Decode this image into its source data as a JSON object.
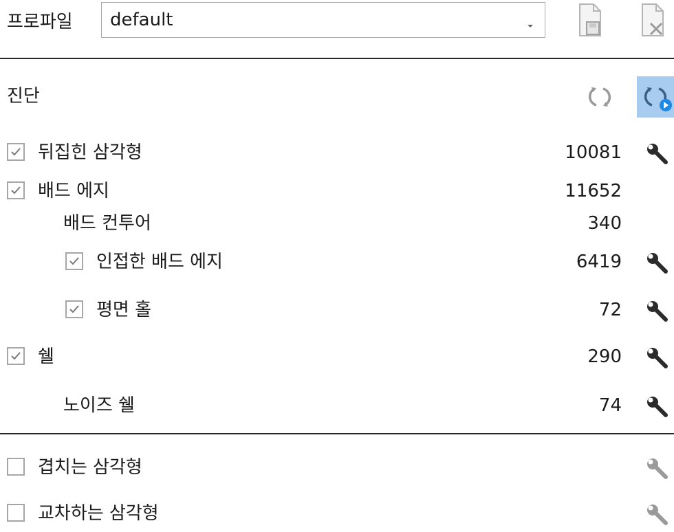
{
  "profile": {
    "label": "프로파일",
    "selected": "default"
  },
  "diagnostics": {
    "title": "진단",
    "items": [
      {
        "label": "뒤집힌 삼각형",
        "count": "10081",
        "checked": true
      },
      {
        "label": "배드 에지",
        "count": "11652",
        "checked": true
      },
      {
        "label": "배드 컨투어",
        "count": "340"
      },
      {
        "label": "인접한 배드 에지",
        "count": "6419",
        "checked": true
      },
      {
        "label": "평면 홀",
        "count": "72",
        "checked": true
      },
      {
        "label": "쉘",
        "count": "290",
        "checked": true
      },
      {
        "label": "노이즈 쉘",
        "count": "74"
      }
    ],
    "extra": [
      {
        "label": "겹치는 삼각형",
        "checked": false
      },
      {
        "label": "교차하는 삼각형",
        "checked": false
      }
    ]
  },
  "colors": {
    "active_button_bg": "#a8ccf0",
    "refresh_accent": "#1e88e5",
    "wrench_enabled": "#2b2b2b",
    "wrench_disabled": "#9a9a9a",
    "checkbox_border": "#a6a6a6"
  },
  "icons": {
    "profile_save": "document-save-icon",
    "profile_delete": "document-delete-icon",
    "refresh": "refresh-icon",
    "auto_refresh": "auto-refresh-icon",
    "fix": "wrench-icon"
  }
}
